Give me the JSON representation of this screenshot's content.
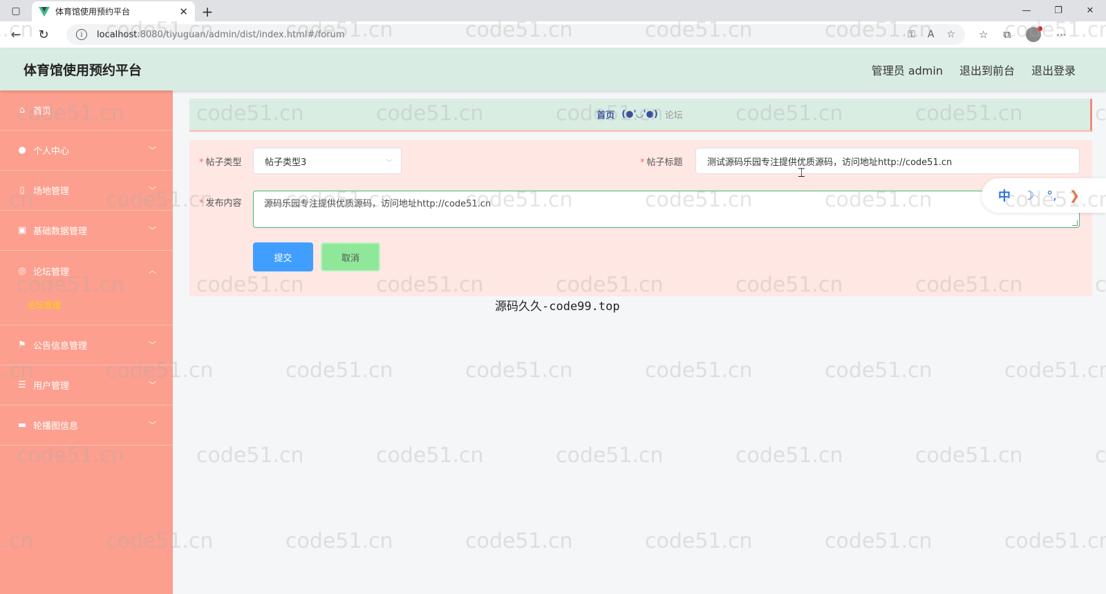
{
  "browser": {
    "tab_title": "体育馆使用预约平台",
    "tab_close": "✕",
    "new_tab": "+",
    "url_host": "localhost",
    "url_path": ":8080/tiyuguan/admin/dist/index.html#/forum",
    "window_controls": [
      "—",
      "❐",
      "✕"
    ]
  },
  "app": {
    "title": "体育馆使用预约平台",
    "user_label": "管理员 admin",
    "front_link": "退出到前台",
    "logout_link": "退出登录"
  },
  "sidebar": {
    "items": [
      {
        "label": "首页",
        "icon": "home-icon",
        "glyph": "⌂",
        "chevron": ""
      },
      {
        "label": "个人中心",
        "icon": "user-icon",
        "glyph": "●",
        "chevron": "﹀"
      },
      {
        "label": "场地管理",
        "icon": "phone-icon",
        "glyph": "▯",
        "chevron": "﹀"
      },
      {
        "label": "基础数据管理",
        "icon": "clipboard-icon",
        "glyph": "▣",
        "chevron": "﹀"
      },
      {
        "label": "论坛管理",
        "icon": "basketball-icon",
        "glyph": "◎",
        "chevron": "︿",
        "sub": "论坛管理"
      },
      {
        "label": "公告信息管理",
        "icon": "flag-icon",
        "glyph": "⚑",
        "chevron": "﹀"
      },
      {
        "label": "用户管理",
        "icon": "list-icon",
        "glyph": "☰",
        "chevron": "﹀"
      },
      {
        "label": "轮播图信息",
        "icon": "briefcase-icon",
        "glyph": "▬",
        "chevron": "﹀"
      }
    ]
  },
  "breadcrumb": {
    "home": "首页",
    "separator": "(●'◡'●)",
    "current": "论坛"
  },
  "form": {
    "type_label": "帖子类型",
    "type_value": "帖子类型3",
    "title_label": "帖子标题",
    "title_value": "测试源码乐园专注提供优质源码，访问地址http://code51.cn",
    "content_label": "发布内容",
    "content_value": "源码乐园专注提供优质源码，访问地址http://code51.cn",
    "submit_label": "提交",
    "cancel_label": "取消"
  },
  "ime": {
    "mode": "中",
    "moon": "☽",
    "dots": "°,",
    "arrow": "❯"
  },
  "caption": "源码久久-code99.top",
  "watermark": "code51.cn"
}
